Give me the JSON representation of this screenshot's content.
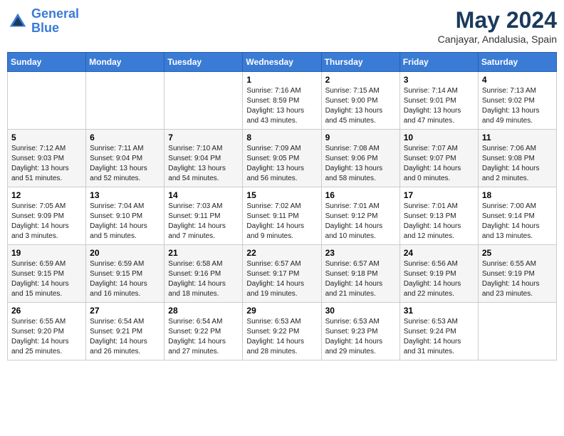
{
  "header": {
    "logo_line1": "General",
    "logo_line2": "Blue",
    "month": "May 2024",
    "location": "Canjayar, Andalusia, Spain"
  },
  "days_of_week": [
    "Sunday",
    "Monday",
    "Tuesday",
    "Wednesday",
    "Thursday",
    "Friday",
    "Saturday"
  ],
  "weeks": [
    [
      {
        "day": "",
        "info": ""
      },
      {
        "day": "",
        "info": ""
      },
      {
        "day": "",
        "info": ""
      },
      {
        "day": "1",
        "info": "Sunrise: 7:16 AM\nSunset: 8:59 PM\nDaylight: 13 hours\nand 43 minutes."
      },
      {
        "day": "2",
        "info": "Sunrise: 7:15 AM\nSunset: 9:00 PM\nDaylight: 13 hours\nand 45 minutes."
      },
      {
        "day": "3",
        "info": "Sunrise: 7:14 AM\nSunset: 9:01 PM\nDaylight: 13 hours\nand 47 minutes."
      },
      {
        "day": "4",
        "info": "Sunrise: 7:13 AM\nSunset: 9:02 PM\nDaylight: 13 hours\nand 49 minutes."
      }
    ],
    [
      {
        "day": "5",
        "info": "Sunrise: 7:12 AM\nSunset: 9:03 PM\nDaylight: 13 hours\nand 51 minutes."
      },
      {
        "day": "6",
        "info": "Sunrise: 7:11 AM\nSunset: 9:04 PM\nDaylight: 13 hours\nand 52 minutes."
      },
      {
        "day": "7",
        "info": "Sunrise: 7:10 AM\nSunset: 9:04 PM\nDaylight: 13 hours\nand 54 minutes."
      },
      {
        "day": "8",
        "info": "Sunrise: 7:09 AM\nSunset: 9:05 PM\nDaylight: 13 hours\nand 56 minutes."
      },
      {
        "day": "9",
        "info": "Sunrise: 7:08 AM\nSunset: 9:06 PM\nDaylight: 13 hours\nand 58 minutes."
      },
      {
        "day": "10",
        "info": "Sunrise: 7:07 AM\nSunset: 9:07 PM\nDaylight: 14 hours\nand 0 minutes."
      },
      {
        "day": "11",
        "info": "Sunrise: 7:06 AM\nSunset: 9:08 PM\nDaylight: 14 hours\nand 2 minutes."
      }
    ],
    [
      {
        "day": "12",
        "info": "Sunrise: 7:05 AM\nSunset: 9:09 PM\nDaylight: 14 hours\nand 3 minutes."
      },
      {
        "day": "13",
        "info": "Sunrise: 7:04 AM\nSunset: 9:10 PM\nDaylight: 14 hours\nand 5 minutes."
      },
      {
        "day": "14",
        "info": "Sunrise: 7:03 AM\nSunset: 9:11 PM\nDaylight: 14 hours\nand 7 minutes."
      },
      {
        "day": "15",
        "info": "Sunrise: 7:02 AM\nSunset: 9:11 PM\nDaylight: 14 hours\nand 9 minutes."
      },
      {
        "day": "16",
        "info": "Sunrise: 7:01 AM\nSunset: 9:12 PM\nDaylight: 14 hours\nand 10 minutes."
      },
      {
        "day": "17",
        "info": "Sunrise: 7:01 AM\nSunset: 9:13 PM\nDaylight: 14 hours\nand 12 minutes."
      },
      {
        "day": "18",
        "info": "Sunrise: 7:00 AM\nSunset: 9:14 PM\nDaylight: 14 hours\nand 13 minutes."
      }
    ],
    [
      {
        "day": "19",
        "info": "Sunrise: 6:59 AM\nSunset: 9:15 PM\nDaylight: 14 hours\nand 15 minutes."
      },
      {
        "day": "20",
        "info": "Sunrise: 6:59 AM\nSunset: 9:15 PM\nDaylight: 14 hours\nand 16 minutes."
      },
      {
        "day": "21",
        "info": "Sunrise: 6:58 AM\nSunset: 9:16 PM\nDaylight: 14 hours\nand 18 minutes."
      },
      {
        "day": "22",
        "info": "Sunrise: 6:57 AM\nSunset: 9:17 PM\nDaylight: 14 hours\nand 19 minutes."
      },
      {
        "day": "23",
        "info": "Sunrise: 6:57 AM\nSunset: 9:18 PM\nDaylight: 14 hours\nand 21 minutes."
      },
      {
        "day": "24",
        "info": "Sunrise: 6:56 AM\nSunset: 9:19 PM\nDaylight: 14 hours\nand 22 minutes."
      },
      {
        "day": "25",
        "info": "Sunrise: 6:55 AM\nSunset: 9:19 PM\nDaylight: 14 hours\nand 23 minutes."
      }
    ],
    [
      {
        "day": "26",
        "info": "Sunrise: 6:55 AM\nSunset: 9:20 PM\nDaylight: 14 hours\nand 25 minutes."
      },
      {
        "day": "27",
        "info": "Sunrise: 6:54 AM\nSunset: 9:21 PM\nDaylight: 14 hours\nand 26 minutes."
      },
      {
        "day": "28",
        "info": "Sunrise: 6:54 AM\nSunset: 9:22 PM\nDaylight: 14 hours\nand 27 minutes."
      },
      {
        "day": "29",
        "info": "Sunrise: 6:53 AM\nSunset: 9:22 PM\nDaylight: 14 hours\nand 28 minutes."
      },
      {
        "day": "30",
        "info": "Sunrise: 6:53 AM\nSunset: 9:23 PM\nDaylight: 14 hours\nand 29 minutes."
      },
      {
        "day": "31",
        "info": "Sunrise: 6:53 AM\nSunset: 9:24 PM\nDaylight: 14 hours\nand 31 minutes."
      },
      {
        "day": "",
        "info": ""
      }
    ]
  ]
}
